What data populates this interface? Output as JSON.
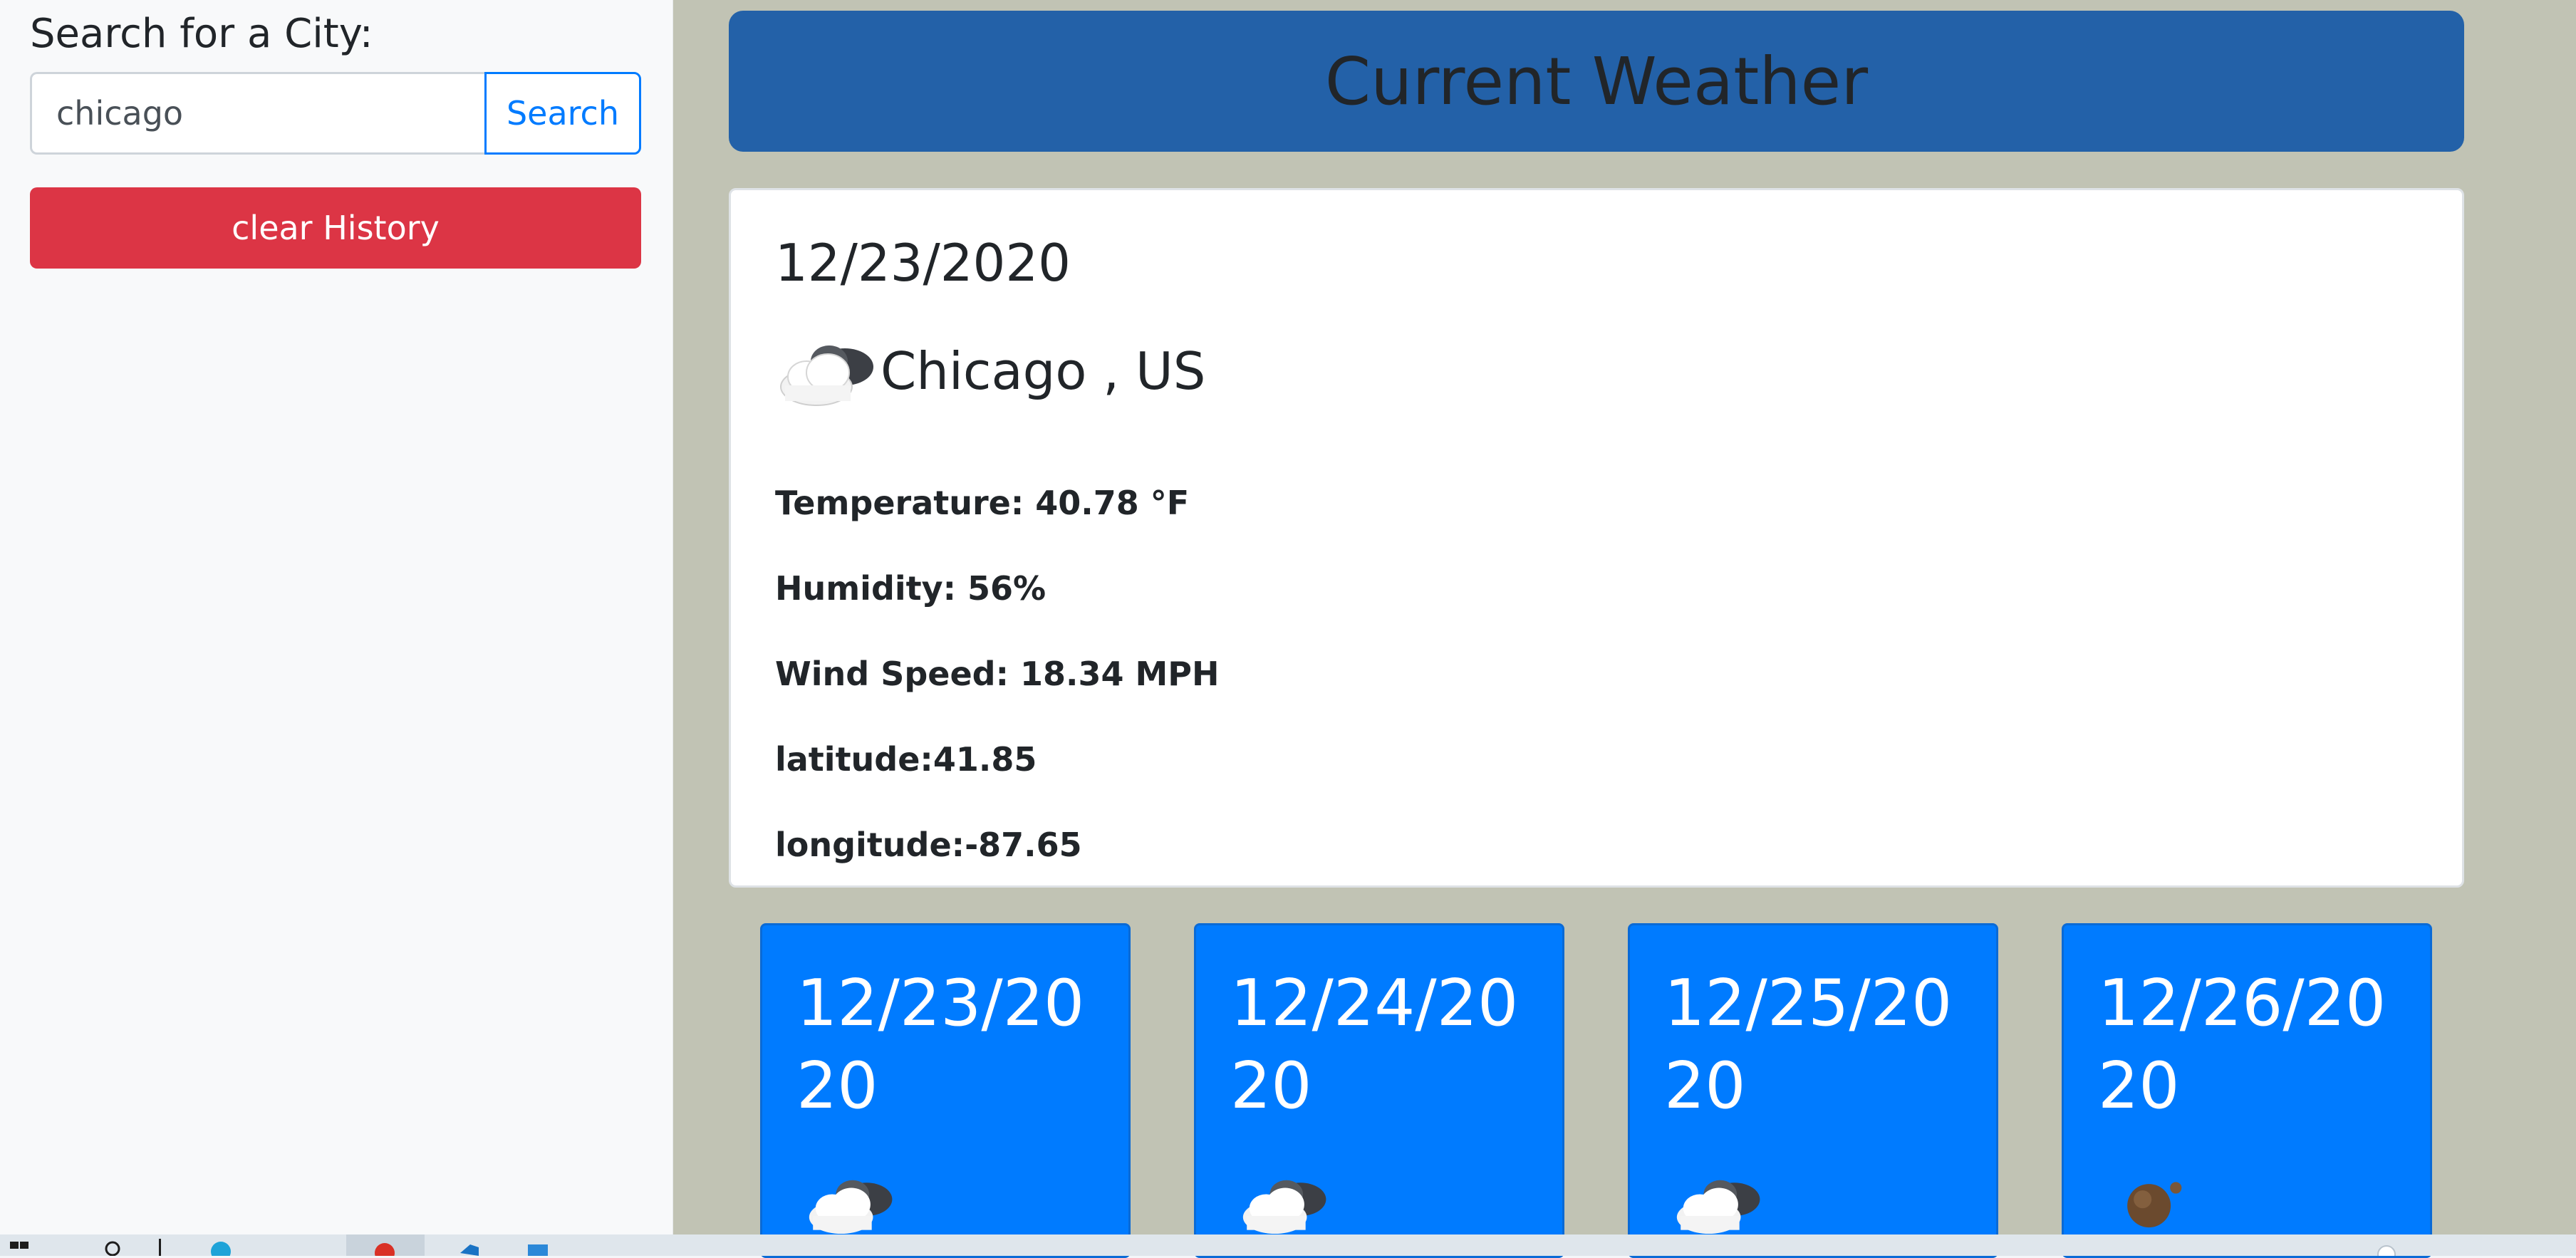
{
  "sidebar": {
    "heading": "Search for a City:",
    "search_value": "chicago",
    "search_placeholder": "",
    "search_button": "Search",
    "clear_button": "clear History"
  },
  "header": {
    "title": "Current Weather"
  },
  "current": {
    "date": "12/23/2020",
    "city": "Chicago , US",
    "icon": "partly-cloudy-icon",
    "temperature": "Temperature: 40.78 °F",
    "humidity": "Humidity: 56%",
    "wind_speed": "Wind Speed: 18.34 MPH",
    "latitude": "latitude:41.85",
    "longitude": "longitude:-87.65"
  },
  "forecast": [
    {
      "date": "12/23/2020",
      "icon": "partly-cloudy-icon"
    },
    {
      "date": "12/24/2020",
      "icon": "partly-cloudy-icon"
    },
    {
      "date": "12/25/2020",
      "icon": "partly-cloudy-icon"
    },
    {
      "date": "12/26/2020",
      "icon": "clear-night-icon"
    }
  ],
  "colors": {
    "banner": "#2361a8",
    "forecast_card": "#007bff",
    "clear_button": "#dc3545",
    "search_button": "#007bff",
    "main_background": "#c1c3b4"
  }
}
